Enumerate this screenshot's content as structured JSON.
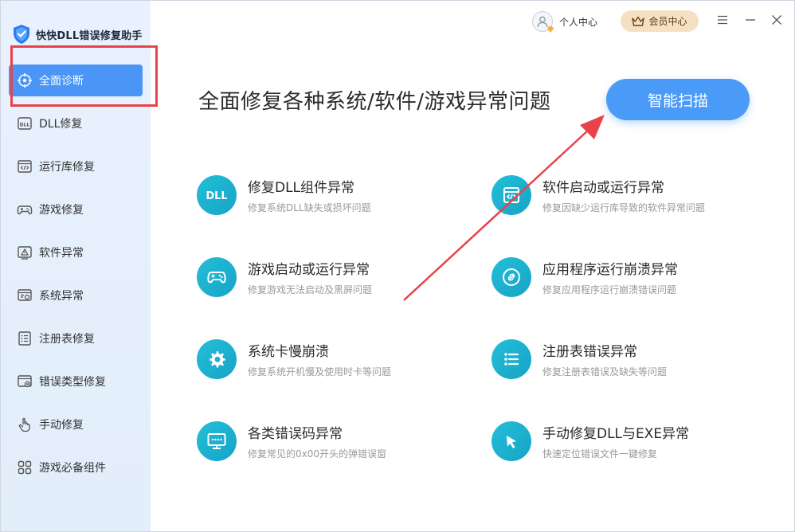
{
  "app": {
    "title": "快快DLL错误修复助手"
  },
  "sidebar": {
    "items": [
      {
        "label": "全面诊断",
        "icon": "crosshair-icon"
      },
      {
        "label": "DLL修复",
        "icon": "dll-file-icon"
      },
      {
        "label": "运行库修复",
        "icon": "code-window-icon"
      },
      {
        "label": "游戏修复",
        "icon": "gamepad-icon"
      },
      {
        "label": "软件异常",
        "icon": "warning-icon"
      },
      {
        "label": "系统异常",
        "icon": "system-gear-icon"
      },
      {
        "label": "注册表修复",
        "icon": "list-icon"
      },
      {
        "label": "错误类型修复",
        "icon": "error-window-icon"
      },
      {
        "label": "手动修复",
        "icon": "hand-pointer-icon"
      },
      {
        "label": "游戏必备组件",
        "icon": "grid-icon"
      }
    ]
  },
  "topbar": {
    "user_center": "个人中心",
    "vip_center": "会员中心"
  },
  "main": {
    "headline": "全面修复各种系统/软件/游戏异常问题",
    "scan_button": "智能扫描",
    "features": [
      {
        "title": "修复DLL组件异常",
        "desc": "修复系统DLL缺失或损坏问题",
        "icon": "dll-badge-icon",
        "icon_text": "DLL"
      },
      {
        "title": "软件启动或运行异常",
        "desc": "修复因缺少运行库导致的软件异常问题",
        "icon": "code-window-icon"
      },
      {
        "title": "游戏启动或运行异常",
        "desc": "修复游戏无法启动及黑屏问题",
        "icon": "gamepad-icon"
      },
      {
        "title": "应用程序运行崩溃异常",
        "desc": "修复应用程序运行崩溃错误问题",
        "icon": "link-icon"
      },
      {
        "title": "系统卡慢崩溃",
        "desc": "修复系统开机慢及使用时卡等问题",
        "icon": "gear-icon"
      },
      {
        "title": "注册表错误异常",
        "desc": "修复注册表错误及缺失等问题",
        "icon": "list-icon"
      },
      {
        "title": "各类错误码异常",
        "desc": "修复常见的0x00开头的弹错误窗",
        "icon": "monitor-icon"
      },
      {
        "title": "手动修复DLL与EXE异常",
        "desc": "快速定位错误文件一键修复",
        "icon": "pointer-icon"
      }
    ]
  },
  "colors": {
    "accent": "#4a95f5",
    "teal": "#1fb3d1",
    "annotation_red": "#e9434a",
    "vip_bg": "#f6e0c2"
  }
}
